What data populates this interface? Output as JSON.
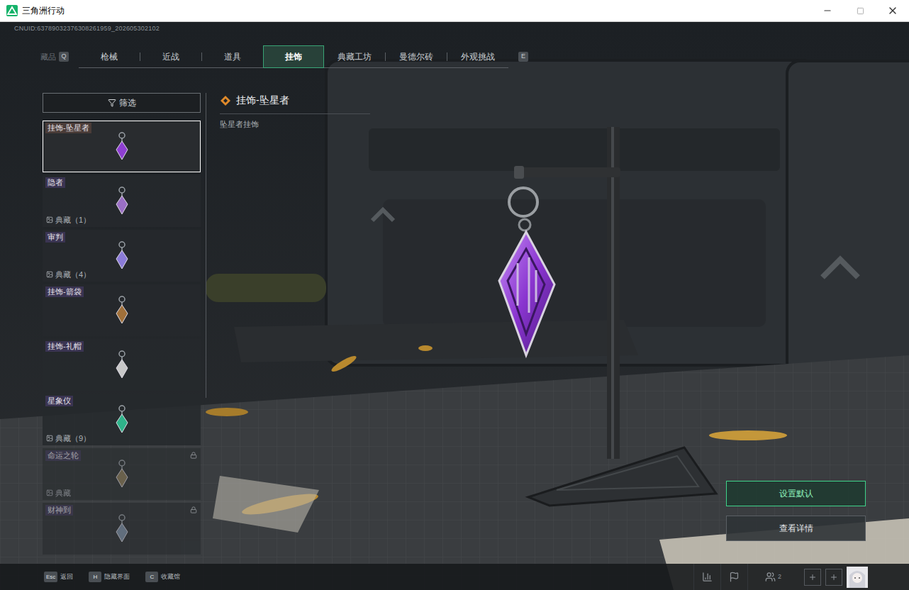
{
  "window": {
    "title": "三角洲行动"
  },
  "uid": "CNUID:63789032376308261959_202605302102",
  "page_title": "藏品",
  "tabs": {
    "prev_key": "Q",
    "next_key": "E",
    "items": [
      {
        "label": "枪械",
        "selected": false
      },
      {
        "label": "近战",
        "selected": false
      },
      {
        "label": "道具",
        "selected": false
      },
      {
        "label": "挂饰",
        "selected": true
      },
      {
        "label": "典藏工坊",
        "selected": false
      },
      {
        "label": "曼德尔砖",
        "selected": false
      },
      {
        "label": "外观挑战",
        "selected": false
      }
    ]
  },
  "filter": {
    "label": "筛选"
  },
  "items": [
    {
      "name": "挂饰-坠星者",
      "collection": "",
      "locked": false,
      "selected": true,
      "color": "#8e3fd1"
    },
    {
      "name": "隐者",
      "collection": "典藏（1）",
      "locked": false,
      "selected": false,
      "color": "#9a6fc4"
    },
    {
      "name": "审判",
      "collection": "典藏（4）",
      "locked": false,
      "selected": false,
      "color": "#8b7bd8"
    },
    {
      "name": "挂饰-箭袋",
      "collection": "",
      "locked": false,
      "selected": false,
      "color": "#a0703a"
    },
    {
      "name": "挂饰-礼帽",
      "collection": "",
      "locked": false,
      "selected": false,
      "color": "#c8c8c8"
    },
    {
      "name": "星象仪",
      "collection": "典藏（9）",
      "locked": false,
      "selected": false,
      "color": "#2fb38a"
    },
    {
      "name": "命运之轮",
      "collection": "典藏",
      "locked": true,
      "selected": false,
      "color": "#8a7a55"
    },
    {
      "name": "财神到",
      "collection": "",
      "locked": true,
      "selected": false,
      "color": "#7b8fa6"
    }
  ],
  "detail": {
    "title": "挂饰-坠星者",
    "subtitle": "坠星者挂饰"
  },
  "actions": [
    {
      "label": "设置默认",
      "kind": "primary"
    },
    {
      "label": "查看详情",
      "kind": "secondary"
    }
  ],
  "footer": {
    "keys": [
      {
        "key": "Esc",
        "label": "返回"
      },
      {
        "key": "H",
        "label": "隐藏界面"
      },
      {
        "key": "C",
        "label": "收藏馆"
      }
    ],
    "friends_count": "2"
  }
}
